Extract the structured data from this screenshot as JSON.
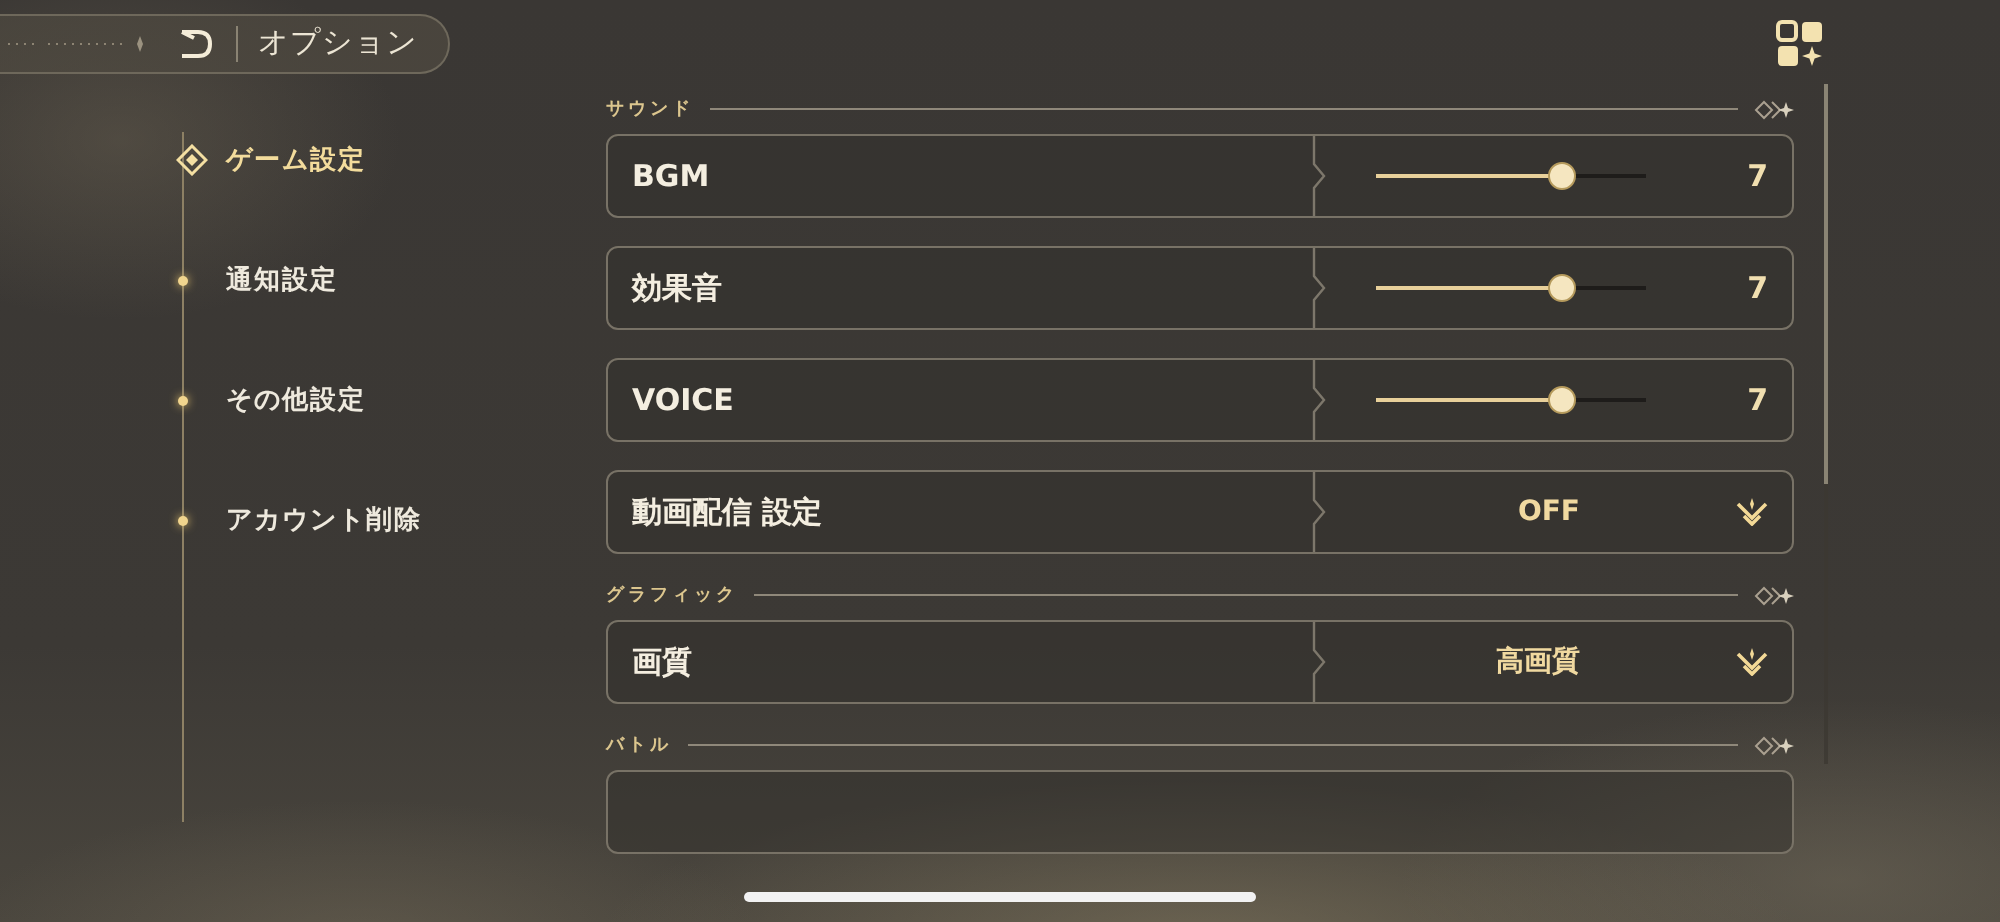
{
  "header": {
    "title": "オプション"
  },
  "sidebar": {
    "items": [
      {
        "label": "ゲーム設定",
        "selected": true
      },
      {
        "label": "通知設定",
        "selected": false
      },
      {
        "label": "その他設定",
        "selected": false
      },
      {
        "label": "アカウント削除",
        "selected": false
      }
    ]
  },
  "sections": [
    {
      "title": "サウンド",
      "rows": [
        {
          "kind": "slider",
          "label": "BGM",
          "level": 0.69,
          "value": "7"
        },
        {
          "kind": "slider",
          "label": "効果音",
          "level": 0.69,
          "value": "7"
        },
        {
          "kind": "slider",
          "label": "VOICE",
          "level": 0.69,
          "value": "7"
        },
        {
          "kind": "select",
          "label": "動画配信 設定",
          "value": "OFF"
        }
      ]
    },
    {
      "title": "グラフィック",
      "rows": [
        {
          "kind": "select",
          "label": "画質",
          "value": "高画質"
        }
      ]
    },
    {
      "title": "バトル",
      "rows": [
        {
          "kind": "cut"
        }
      ]
    }
  ]
}
